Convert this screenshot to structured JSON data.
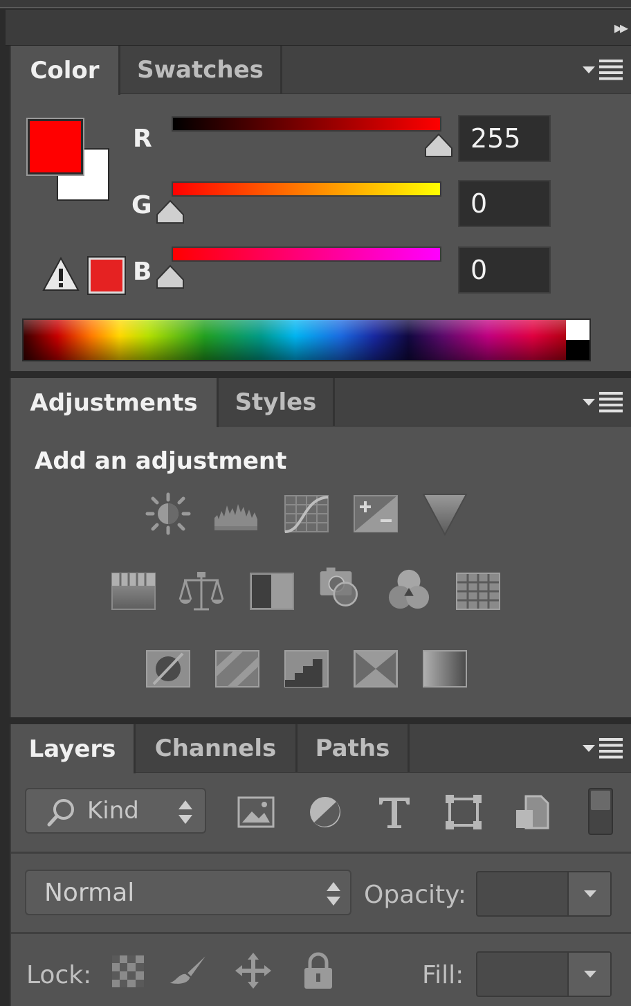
{
  "panel_strip": {
    "collapse_glyph": "▸▸"
  },
  "color_panel": {
    "tabs": [
      {
        "label": "Color",
        "active": true
      },
      {
        "label": "Swatches",
        "active": false
      }
    ],
    "foreground": "#ff0000",
    "background": "#ffffff",
    "channels": [
      {
        "label": "R",
        "value": "255"
      },
      {
        "label": "G",
        "value": "0"
      },
      {
        "label": "B",
        "value": "0"
      }
    ],
    "gamut_warning_icon": "warning-triangle-icon",
    "gamut_color": "#e52222"
  },
  "adjustments_panel": {
    "tabs": [
      {
        "label": "Adjustments",
        "active": true
      },
      {
        "label": "Styles",
        "active": false
      }
    ],
    "heading": "Add an adjustment",
    "icons_row1": [
      "brightness-contrast-icon",
      "levels-icon",
      "curves-icon",
      "exposure-icon",
      "vibrance-icon"
    ],
    "icons_row2": [
      "hue-saturation-icon",
      "color-balance-icon",
      "black-white-icon",
      "photo-filter-icon",
      "channel-mixer-icon",
      "color-lookup-icon"
    ],
    "icons_row3": [
      "invert-icon",
      "posterize-icon",
      "threshold-icon",
      "selective-color-icon",
      "gradient-map-icon"
    ]
  },
  "layers_panel": {
    "tabs": [
      {
        "label": "Layers",
        "active": true
      },
      {
        "label": "Channels",
        "active": false
      },
      {
        "label": "Paths",
        "active": false
      }
    ],
    "filter": {
      "label": "Kind"
    },
    "blend_mode": "Normal",
    "opacity_label": "Opacity:",
    "lock_label": "Lock:",
    "fill_label": "Fill:"
  }
}
